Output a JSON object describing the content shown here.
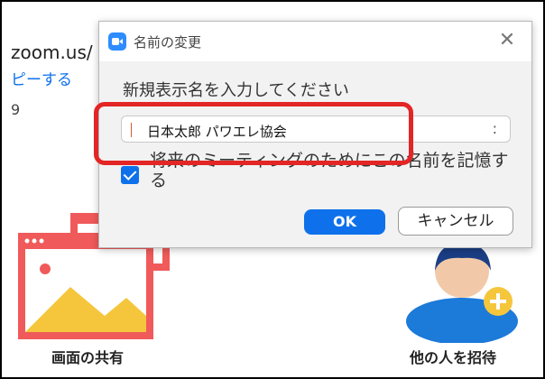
{
  "background": {
    "url_fragment": "zoom.us/",
    "link_fragment": "ピーする",
    "misc_fragment": "9",
    "share_label": "画面の共有",
    "invite_label": "他の人を招待"
  },
  "dialog": {
    "title": "名前の変更",
    "close_symbol": "✕",
    "prompt": "新規表示名を入力してください",
    "name_value": "日本太郎 パワエレ協会",
    "input_trailing": ":",
    "remember_label": "将来のミーティングのためにこの名前を記憶する",
    "remember_checked": true,
    "ok_label": "OK",
    "cancel_label": "キャンセル"
  },
  "colors": {
    "accent": "#0e71eb",
    "highlight": "#e32525",
    "share_tile": "#f05a5a",
    "invite_tile": "#1c7ad9"
  },
  "icons": {
    "app": "zoom-app-icon",
    "close": "close-icon",
    "share": "share-screen-icon",
    "invite": "invite-person-icon"
  }
}
